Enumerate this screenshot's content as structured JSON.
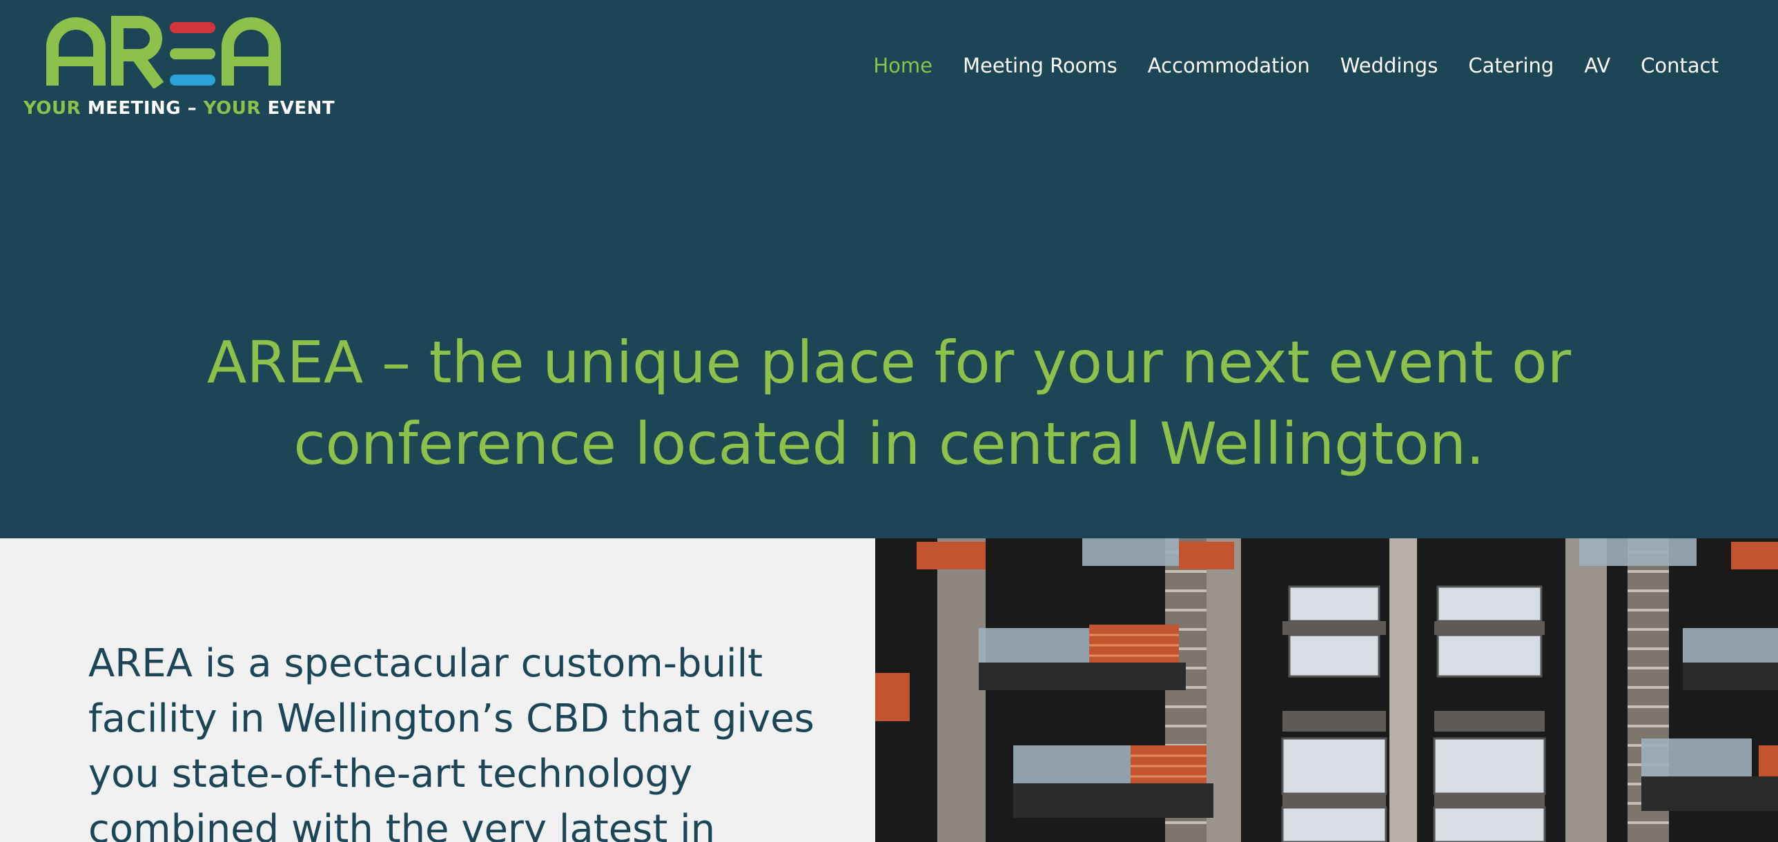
{
  "logo": {
    "wordmark": "AREA",
    "tagline_part1": "YOUR",
    "tagline_part2": "MEETING –",
    "tagline_part3": "YOUR",
    "tagline_part4": "EVENT",
    "colors": {
      "green": "#8cc24b",
      "red": "#d6343c",
      "blue": "#2ba3d8"
    }
  },
  "nav": {
    "items": [
      {
        "label": "Home",
        "active": true
      },
      {
        "label": "Meeting Rooms",
        "active": false
      },
      {
        "label": "Accommodation",
        "active": false
      },
      {
        "label": "Weddings",
        "active": false
      },
      {
        "label": "Catering",
        "active": false
      },
      {
        "label": "AV",
        "active": false
      },
      {
        "label": "Contact",
        "active": false
      }
    ]
  },
  "hero": {
    "headline": "AREA – the unique place for your next event or conference located in central Wellington."
  },
  "intro": {
    "text": "AREA is a spectacular custom-built facility in Wellington’s CBD that  gives you state-of-the-art technology combined with the very latest in"
  },
  "theme": {
    "primary_bg": "#1c4556",
    "accent": "#8cc24b",
    "light_bg": "#f1f1f1"
  }
}
